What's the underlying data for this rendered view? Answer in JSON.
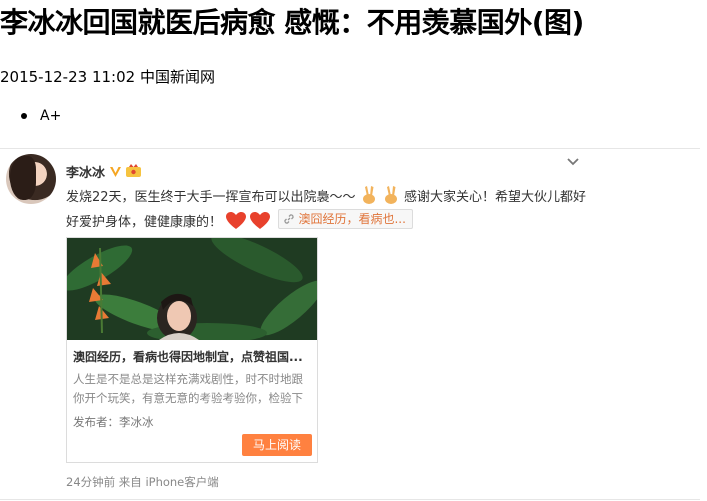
{
  "headline": "李冰冰回国就医后病愈 感慨：不用羡慕国外(图)",
  "meta": {
    "datetime": "2015-12-23 11:02",
    "source": "中国新闻网"
  },
  "font_controls": [
    "A+"
  ],
  "post": {
    "author": "李冰冰",
    "text_part1": "发烧22天，医生终于大手一挥宣布可以出院裊～～",
    "text_part2": "感谢大家关心！希望大伙儿都好好爱护身体，健健康康的！",
    "link_chip": "澳囧经历，看病也...",
    "icons": [
      "avatar",
      "verified-v-icon",
      "level-badge-icon",
      "chevron-down-icon",
      "victory-hand-emoji",
      "heart-emoji",
      "link-icon"
    ],
    "article": {
      "title": "澳囧经历，看病也得因地制宜，点赞祖国...",
      "summary": "人生是不是总是这样充满戏剧性，时不时地跟你开个玩笑，有意无意的考验考验你，检验下",
      "publisher": "发布者：李冰冰",
      "read_button": "马上阅读"
    },
    "footer": "24分钟前 来自 iPhone客户端"
  },
  "colors": {
    "link": "#e0753b",
    "button": "#ff8140",
    "muted": "#888888"
  }
}
